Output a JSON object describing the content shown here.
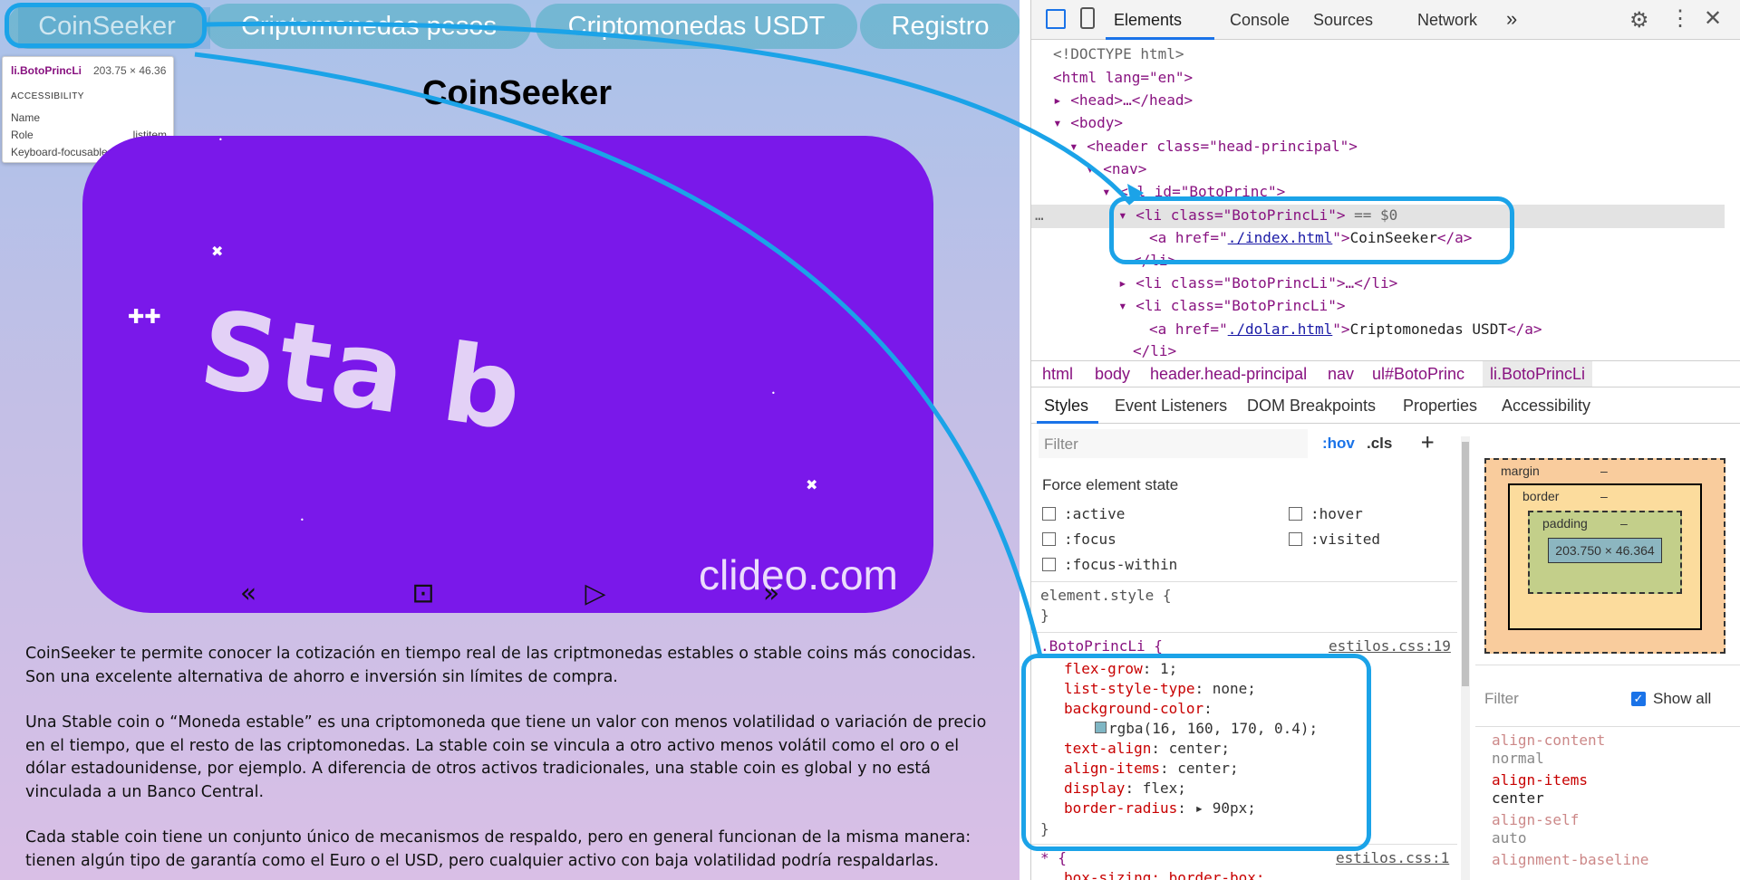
{
  "nav": {
    "items": [
      "CoinSeeker",
      "Criptomonedas pesos",
      "Criptomonedas USDT",
      "Registro"
    ]
  },
  "tooltip": {
    "selector": "li.BotoPrincLi",
    "size": "203.75 × 46.36",
    "section": "ACCESSIBILITY",
    "rows": [
      {
        "label": "Name",
        "value": ""
      },
      {
        "label": "Role",
        "value": "listitem"
      },
      {
        "label": "Keyboard-focusable",
        "value": "⊘"
      }
    ]
  },
  "page": {
    "title": "CoinSeeker",
    "video_text": "Sta b",
    "watermark": "clideo.com",
    "controls": {
      "rewind": "«",
      "stop": "⊡",
      "play": "▷",
      "forward": "»"
    },
    "paragraphs": [
      "CoinSeeker te permite conocer la cotización en tiempo real de las criptmonedas estables o stable coins más conocidas. Son una excelente alternativa de ahorro e inversión sin límites de compra.",
      "Una Stable coin o “Moneda estable” es una criptomoneda que tiene un valor con menos volatilidad o variación de precio en el tiempo, que el resto de las criptomonedas. La stable coin se vincula a otro activo menos volátil como el oro o el dólar estadounidense, por ejemplo. A diferencia de otros activos tradicionales, una stable coin es global y no está vinculada a un Banco Central.",
      "Cada stable coin tiene un conjunto único de mecanismos de respaldo, pero en general funcionan de la misma manera: tienen algún tipo de garantía como el Euro o el USD, pero cualquier activo con baja volatilidad podría respaldarlas."
    ]
  },
  "devtools": {
    "tabs": [
      "Elements",
      "Console",
      "Sources",
      "Network",
      "»"
    ],
    "dom": {
      "doctype": "<!DOCTYPE html>",
      "html_open": "<html lang=\"en\">",
      "head": "<head>…</head>",
      "body": "<body>",
      "header": "<header class=\"head-principal\">",
      "nav": "<nav>",
      "ul": "<ul id=\"BotoPrinc\">",
      "li_selected": "<li class=\"BotoPrincLi\">",
      "selected_marker": "== $0",
      "a1_href": "./index.html",
      "a1_text": "CoinSeeker",
      "li_close": "</li>",
      "li_collapsed": "<li class=\"BotoPrincLi\">…</li>",
      "li3": "<li class=\"BotoPrincLi\">",
      "a3_href": "./dolar.html",
      "a3_text": "Criptomonedas USDT",
      "li_close2": "</li>"
    },
    "breadcrumbs": [
      "html",
      "body",
      "header.head-principal",
      "nav",
      "ul#BotoPrinc",
      "li.BotoPrincLi"
    ],
    "subtabs": [
      "Styles",
      "Event Listeners",
      "DOM Breakpoints",
      "Properties",
      "Accessibility"
    ],
    "filter_placeholder": "Filter",
    "hov": ":hov",
    "cls": ".cls",
    "force_state_title": "Force element state",
    "states": [
      ":active",
      ":hover",
      ":focus",
      ":visited",
      ":focus-within"
    ],
    "element_style": "element.style {",
    "rule_selector": ".BotoPrincLi {",
    "rule_source": "estilos.css:19",
    "declarations": [
      {
        "prop": "flex-grow",
        "val": "1;"
      },
      {
        "prop": "list-style-type",
        "val": "none;"
      },
      {
        "prop": "background-color",
        "val": ""
      },
      {
        "prop": "",
        "val": "rgba(16, 160, 170, 0.4);"
      },
      {
        "prop": "text-align",
        "val": "center;"
      },
      {
        "prop": "align-items",
        "val": "center;"
      },
      {
        "prop": "display",
        "val": "flex;"
      },
      {
        "prop": "border-radius",
        "val": "▸ 90px;"
      }
    ],
    "star_rule": "* {",
    "star_source": "estilos.css:1",
    "star_prop": "box-sizing: border-box;",
    "boxmodel": {
      "margin": "margin",
      "border": "border",
      "padding": "padding",
      "content": "203.750 × 46.364",
      "dash": "–"
    },
    "computed_filter": "Filter",
    "show_all": "Show all",
    "computed": [
      {
        "prop": "align-content",
        "val": "normal"
      },
      {
        "prop": "align-items",
        "val": "center"
      },
      {
        "prop": "align-self",
        "val": "auto"
      },
      {
        "prop": "alignment-baseline",
        "val": ""
      }
    ]
  },
  "colors": {
    "callout": "#1ba3e8",
    "video": "#7a18ea",
    "nav_bg": "rgba(16,160,170,0.4)"
  }
}
